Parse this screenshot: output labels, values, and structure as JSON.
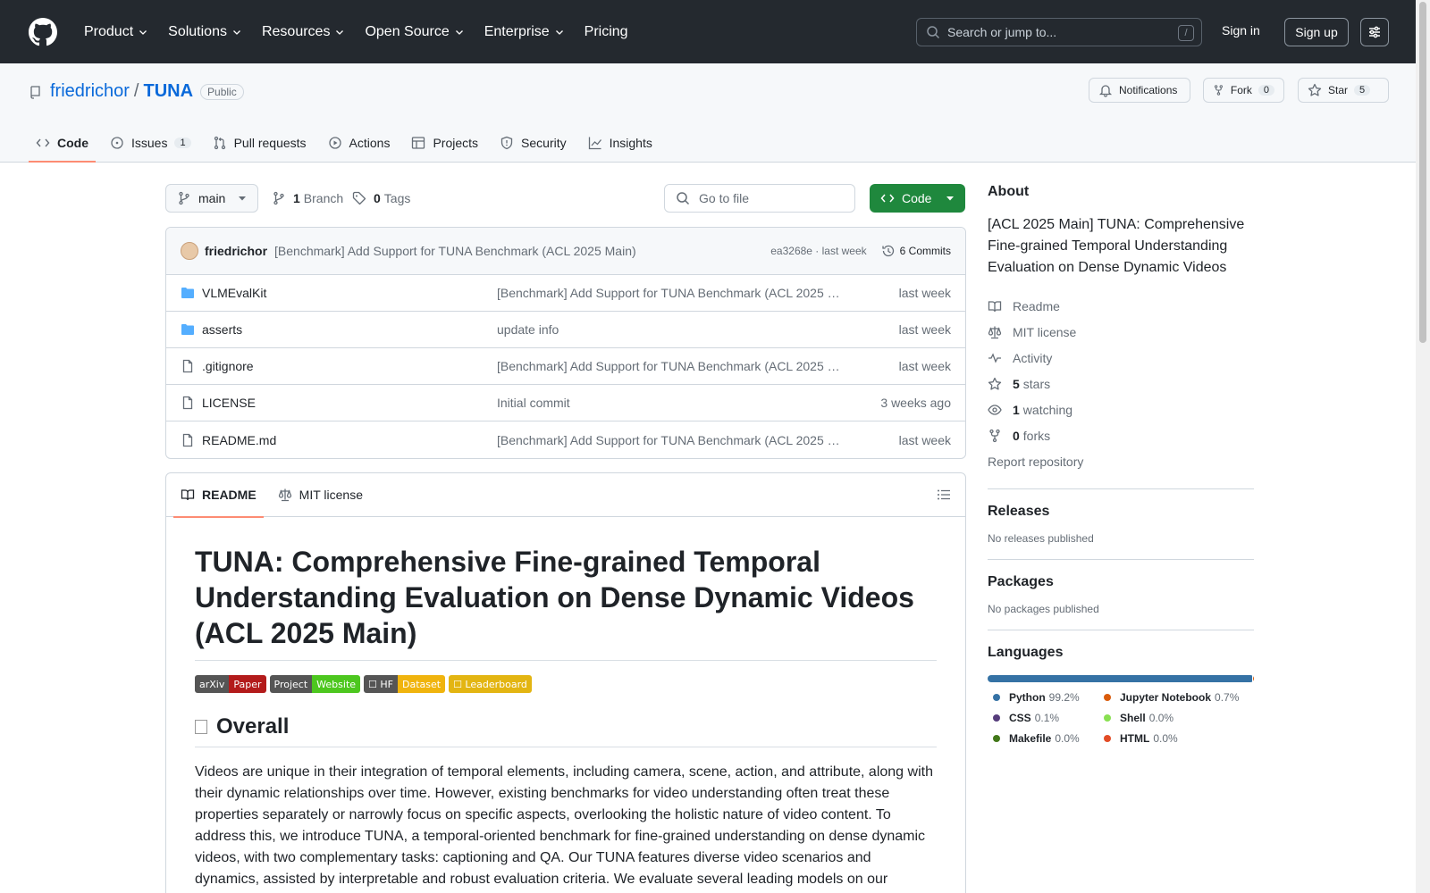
{
  "header": {
    "nav": [
      {
        "label": "Product",
        "dropdown": true
      },
      {
        "label": "Solutions",
        "dropdown": true
      },
      {
        "label": "Resources",
        "dropdown": true
      },
      {
        "label": "Open Source",
        "dropdown": true
      },
      {
        "label": "Enterprise",
        "dropdown": true
      },
      {
        "label": "Pricing",
        "dropdown": false
      }
    ],
    "search_placeholder": "Search or jump to...",
    "search_shortcut": "/",
    "signin": "Sign in",
    "signup": "Sign up"
  },
  "repo": {
    "owner": "friedrichor",
    "separator": "/",
    "name": "TUNA",
    "visibility": "Public",
    "notifications": "Notifications",
    "fork_label": "Fork",
    "fork_count": "0",
    "star_label": "Star",
    "star_count": "5",
    "tabs": [
      {
        "label": "Code",
        "count": null
      },
      {
        "label": "Issues",
        "count": "1"
      },
      {
        "label": "Pull requests",
        "count": null
      },
      {
        "label": "Actions",
        "count": null
      },
      {
        "label": "Projects",
        "count": null
      },
      {
        "label": "Security",
        "count": null
      },
      {
        "label": "Insights",
        "count": null
      }
    ]
  },
  "branchbar": {
    "branch": "main",
    "branch_count": "1",
    "branch_label": "Branch",
    "tag_count": "0",
    "tag_label": "Tags",
    "goto_placeholder": "Go to file",
    "code_label": "Code"
  },
  "commit": {
    "author": "friedrichor",
    "message": "[Benchmark] Add Support for TUNA Benchmark (ACL 2025 Main)",
    "sha_time": "ea3268e · last week",
    "commits": "6 Commits"
  },
  "files": [
    {
      "name": "VLMEvalKit",
      "type": "folder",
      "message": "[Benchmark] Add Support for TUNA Benchmark (ACL 2025 Main)",
      "date": "last week"
    },
    {
      "name": "asserts",
      "type": "folder",
      "message": "update info",
      "date": "last week"
    },
    {
      "name": ".gitignore",
      "type": "file",
      "message": "[Benchmark] Add Support for TUNA Benchmark (ACL 2025 Main)",
      "date": "last week"
    },
    {
      "name": "LICENSE",
      "type": "file",
      "message": "Initial commit",
      "date": "3 weeks ago"
    },
    {
      "name": "README.md",
      "type": "file",
      "message": "[Benchmark] Add Support for TUNA Benchmark (ACL 2025 Main)",
      "date": "last week"
    }
  ],
  "readme": {
    "tab_readme": "README",
    "tab_license": "MIT license",
    "title": "TUNA: Comprehensive Fine-grained Temporal Understanding Evaluation on Dense Dynamic Videos (ACL 2025 Main)",
    "badges": [
      {
        "left": "arXiv",
        "right": "Paper",
        "color": "#b31b1b"
      },
      {
        "left": "Project",
        "right": "Website",
        "color": "#4dc71f"
      },
      {
        "left": "☐ HF",
        "right": "Dataset",
        "color": "#f0b40e"
      },
      {
        "left": "☐ Leaderboard",
        "right": "",
        "color": "#e3b512"
      }
    ],
    "section": "Overall",
    "paragraph": "Videos are unique in their integration of temporal elements, including camera, scene, action, and attribute, along with their dynamic relationships over time. However, existing benchmarks for video understanding often treat these properties separately or narrowly focus on specific aspects, overlooking the holistic nature of video content. To address this, we introduce TUNA, a temporal-oriented benchmark for fine-grained understanding on dense dynamic videos, with two complementary tasks: captioning and QA. Our TUNA features diverse video scenarios and dynamics, assisted by interpretable and robust evaluation criteria. We evaluate several leading models on our"
  },
  "about": {
    "title": "About",
    "description": "[ACL 2025 Main] TUNA: Comprehensive Fine-grained Temporal Understanding Evaluation on Dense Dynamic Videos",
    "links": [
      {
        "icon": "book-icon",
        "bold": "",
        "text": "Readme"
      },
      {
        "icon": "scale-icon",
        "bold": "",
        "text": "MIT license"
      },
      {
        "icon": "pulse-icon",
        "bold": "",
        "text": "Activity"
      },
      {
        "icon": "star-icon",
        "bold": "5",
        "text": "stars"
      },
      {
        "icon": "eye-icon",
        "bold": "1",
        "text": "watching"
      },
      {
        "icon": "fork-icon",
        "bold": "0",
        "text": "forks"
      }
    ],
    "report": "Report repository"
  },
  "releases": {
    "title": "Releases",
    "note": "No releases published"
  },
  "packages": {
    "title": "Packages",
    "note": "No packages published"
  },
  "languages": {
    "title": "Languages",
    "items": [
      {
        "name": "Python",
        "percent": "99.2%",
        "value": 99.2,
        "color": "#3572A5"
      },
      {
        "name": "Jupyter Notebook",
        "percent": "0.7%",
        "value": 0.7,
        "color": "#DA5B0B"
      },
      {
        "name": "CSS",
        "percent": "0.1%",
        "value": 0.1,
        "color": "#563d7c"
      },
      {
        "name": "Shell",
        "percent": "0.0%",
        "value": 0.0,
        "color": "#89e051"
      },
      {
        "name": "Makefile",
        "percent": "0.0%",
        "value": 0.0,
        "color": "#427819"
      },
      {
        "name": "HTML",
        "percent": "0.0%",
        "value": 0.0,
        "color": "#e34c26"
      }
    ]
  }
}
